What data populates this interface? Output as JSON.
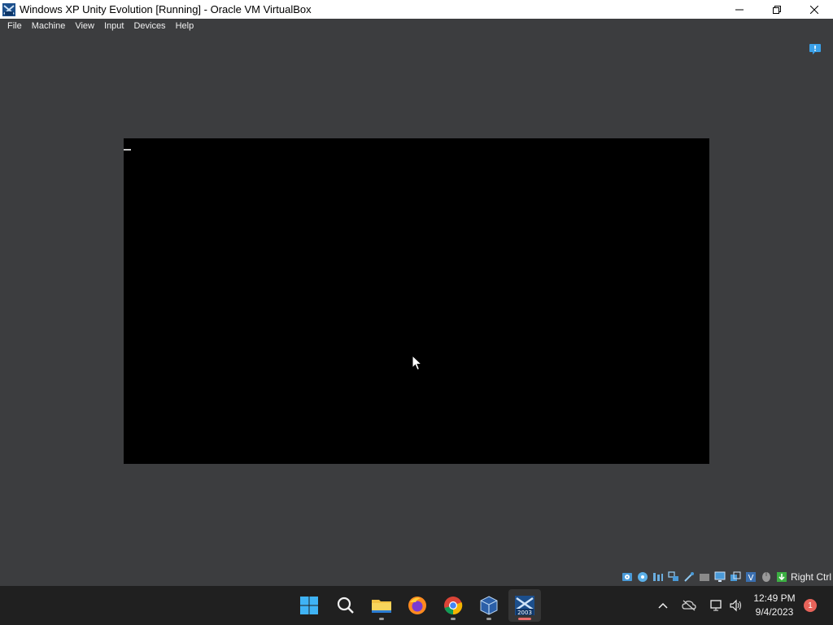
{
  "window": {
    "title": "Windows XP Unity Evolution [Running] - Oracle VM VirtualBox",
    "app_icon": "virtualbox-icon",
    "controls": [
      "minimize-icon",
      "maximize-icon",
      "close-icon"
    ]
  },
  "menubar": {
    "items": [
      {
        "label": "File"
      },
      {
        "label": "Machine"
      },
      {
        "label": "View"
      },
      {
        "label": "Input"
      },
      {
        "label": "Devices"
      },
      {
        "label": "Help"
      }
    ]
  },
  "notification_icon": "message-info-icon",
  "vm": {
    "screen_color": "#000000",
    "text_cursor": "_"
  },
  "statusbar": {
    "icons": [
      "hard-disk-icon",
      "optical-drive-icon",
      "audio-icon",
      "network-icon",
      "usb-icon",
      "shared-folders-icon",
      "display-icon",
      "recording-icon",
      "virtualization-icon",
      "mouse-integration-icon",
      "keyboard-icon"
    ],
    "host_key": "Right Ctrl"
  },
  "taskbar": {
    "apps": [
      {
        "name": "start-button",
        "icon": "windows-logo-icon"
      },
      {
        "name": "search-button",
        "icon": "search-icon"
      },
      {
        "name": "file-explorer",
        "icon": "folder-icon"
      },
      {
        "name": "firefox",
        "icon": "firefox-icon"
      },
      {
        "name": "chrome",
        "icon": "chrome-icon"
      },
      {
        "name": "virtualbox-manager",
        "icon": "virtualbox-icon"
      },
      {
        "name": "vm-window",
        "icon": "vm-2003-icon",
        "badge_text": "2003"
      }
    ],
    "tray": {
      "icons": [
        "chevron-up-icon",
        "onedrive-offline-icon",
        "network-icon",
        "volume-icon"
      ],
      "time": "12:49 PM",
      "date": "9/4/2023",
      "notification_count": "1"
    }
  },
  "colors": {
    "background": "#3c3d3f",
    "taskbar": "#202020",
    "titlebar": "#ffffff",
    "accent_red": "#e86b6b"
  }
}
